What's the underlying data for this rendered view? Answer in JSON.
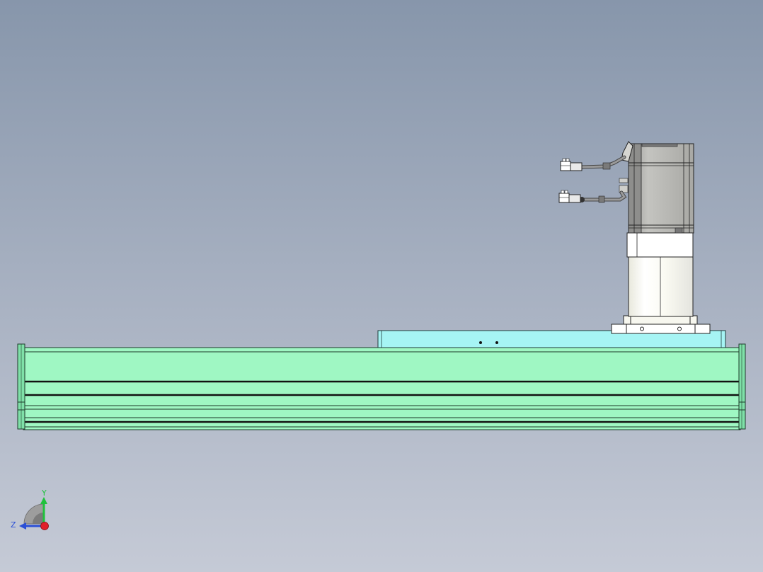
{
  "viewer": {
    "background_top": "#8796ab",
    "background_bottom": "#c5cad6"
  },
  "model": {
    "rail_color": "#9ff7c3",
    "carriage_color": "#a6f4f4",
    "motor_color": "#b8b8b5",
    "reducer_color": "#fbfbf3"
  },
  "triad": {
    "y_label": "Y",
    "z_label": "Z",
    "y_color": "#1fc23c",
    "z_color": "#2a4fd6",
    "x_color": "#e0202a"
  }
}
